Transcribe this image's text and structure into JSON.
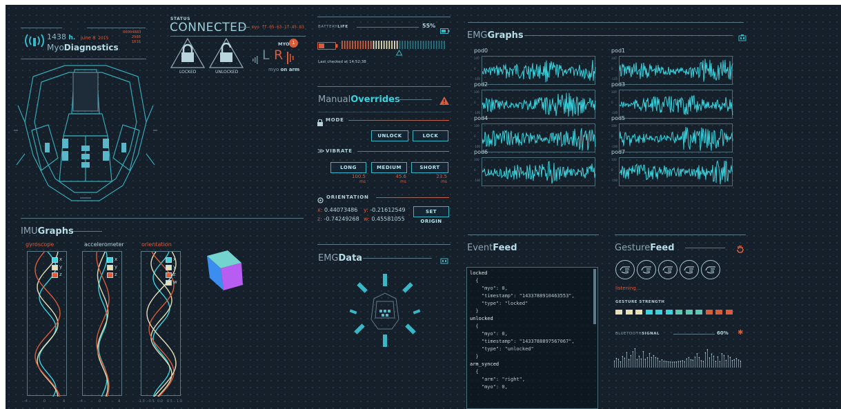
{
  "header": {
    "time": "1438",
    "time_unit": "h.",
    "date": "june 8",
    "year": "2015",
    "app_name_light": "Myo",
    "app_name_bold": "Diagnostics",
    "nums": [
      "00004883",
      "2986",
      "1016"
    ]
  },
  "status": {
    "label": "STATUS",
    "value": "CONNECTED",
    "myo_id": "myo ff-05-63-1f-45-83",
    "locked_label": "LOCKED",
    "unlocked_label": "UNLOCKED",
    "myo_label": "MYO",
    "myo_badge": "1",
    "arm_left": "L",
    "arm_right": "R",
    "on_arm_prefix": "myo",
    "on_arm": "on arm"
  },
  "battery": {
    "label_prefix": "BATTERY",
    "label_bold": "LIFE",
    "percent": "55%",
    "level": 0.55,
    "last_checked": "Last checked at 14:52:38"
  },
  "overrides": {
    "title_light": "Manual",
    "title_bold": "Overrides",
    "mode_label": "MODE",
    "unlock_btn": "UNLOCK",
    "lock_btn": "LOCK",
    "vibrate_label": "VIBRATE",
    "long_btn": "LONG",
    "medium_btn": "MEDIUM",
    "short_btn": "SHORT",
    "long_val": "100.5",
    "medium_val": "45.6",
    "short_val": "23.5",
    "unit": "ms",
    "orientation_label": "ORIENTATION",
    "x_label": "x:",
    "x_val": "0.44073486",
    "y_label": "y:",
    "y_val": "-0.21612549",
    "z_label": "z:",
    "z_val": "-0.74249268",
    "w_label": "w:",
    "w_val": "0.45581055",
    "set_origin_btn": "SET ORIGIN"
  },
  "emg_graphs": {
    "title_light": "EMG",
    "title_bold": "Graphs",
    "pods": [
      "pod0",
      "pod1",
      "pod2",
      "pod3",
      "pod4",
      "pod5",
      "pod6",
      "pod7"
    ],
    "axis_top": "100",
    "axis_mid": "0",
    "axis_bottom": "-100"
  },
  "imu": {
    "title_light": "IMU",
    "title_bold": "Graphs",
    "gyroscope": "gyroscope",
    "accelerometer": "accelerometer",
    "orientation": "orientation",
    "x": "x",
    "y": "y",
    "z": "z",
    "w": "w",
    "gyro_ticks": [
      "-4",
      "0",
      "4"
    ],
    "accel_ticks": [
      "-4",
      "0",
      "4"
    ],
    "orient_ticks": [
      "-1.0",
      "-0.5",
      "0.0",
      "0.5",
      "1.0"
    ]
  },
  "emg_data": {
    "title_light": "EMG",
    "title_bold": "Data"
  },
  "event_feed": {
    "title_light": "Event",
    "title_bold": "Feed",
    "lines": [
      "locked",
      "  {",
      "    \"myo\": 0,",
      "    \"timestamp\": \"1433788910463553\",",
      "    \"type\": \"locked\"",
      "  }",
      "unlocked",
      "  {",
      "    \"myo\": 0,",
      "    \"timestamp\": \"1433788897567067\",",
      "    \"type\": \"unlocked\"",
      "  }",
      "arm_synced",
      "  {",
      "    \"arm\": \"right\",",
      "    \"myo\": 0,"
    ]
  },
  "gesture_feed": {
    "title_light": "Gesture",
    "title_bold": "Feed",
    "status": "listening...",
    "strength_label": "GESTURE STRENGTH",
    "bluetooth_prefix": "BLUETOOTH",
    "bluetooth_bold": "SIGNAL",
    "bluetooth_percent": "60%",
    "bluetooth_level": 0.6,
    "icons": [
      "fist-gesture-icon",
      "wave-in-gesture-icon",
      "wave-out-gesture-icon",
      "fingers-spread-gesture-icon",
      "double-tap-gesture-icon"
    ]
  },
  "colors": {
    "background": "#15202b",
    "accent": "#3ad2dc",
    "warning": "#d95d3b",
    "cream": "#e8dfb8"
  }
}
